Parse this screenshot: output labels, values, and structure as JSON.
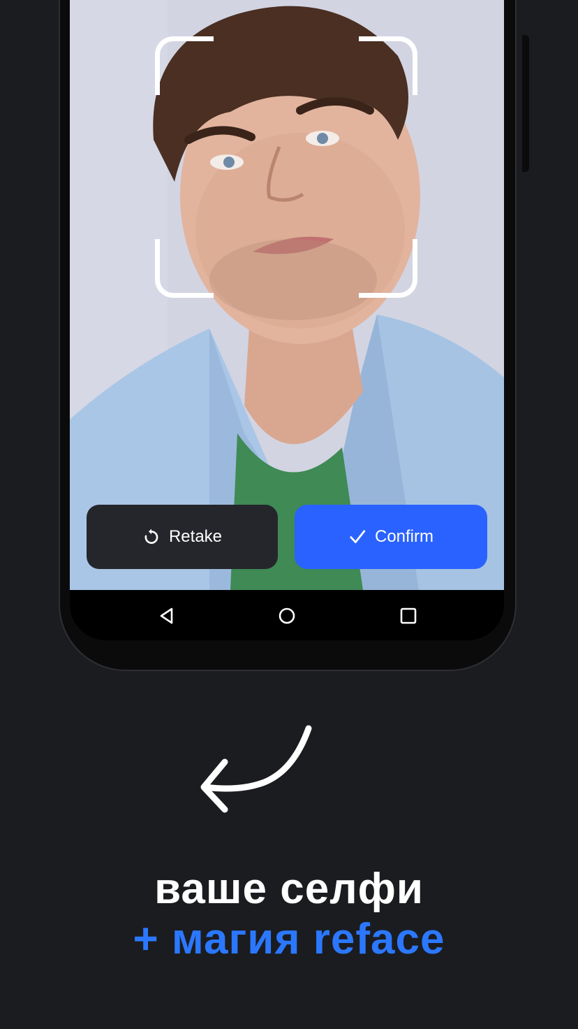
{
  "camera": {
    "retake_label": "Retake",
    "confirm_label": "Confirm",
    "retake_icon": "retake-icon",
    "confirm_icon": "check-icon"
  },
  "nav_bar": {
    "items": [
      "back-icon",
      "home-icon",
      "recents-icon"
    ]
  },
  "promo": {
    "line1": "ваше селфи",
    "line2": "+ магия reface"
  },
  "colors": {
    "background": "#1b1c20",
    "accent": "#2b78ff",
    "confirm_button": "#2a62ff",
    "retake_button": "#25262b"
  }
}
